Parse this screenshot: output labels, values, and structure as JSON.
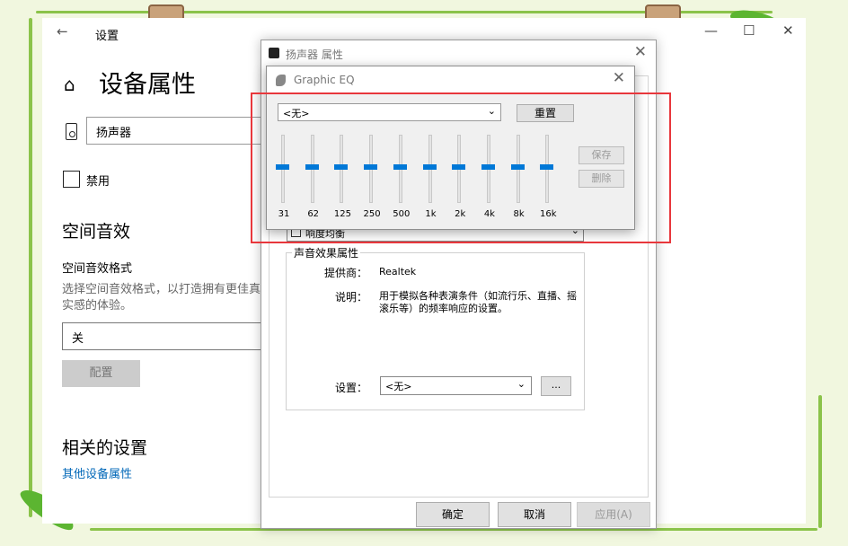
{
  "settings": {
    "title": "设置",
    "back_icon": "←",
    "controls": [
      "—",
      "☐",
      "✕"
    ],
    "home_icon": "⌂",
    "heading": "设备属性",
    "device_name": "扬声器",
    "disable_label": "禁用",
    "spatial_title": "空间音效",
    "spatial_format_label": "空间音效格式",
    "spatial_format_desc": "选择空间音效格式，以打造拥有更佳真实感的体验。",
    "spatial_format_value": "关",
    "config_button": "配置",
    "related_title": "相关的设置",
    "other_device_link": "其他设备属性"
  },
  "speaker_props": {
    "title": "扬声器 属性",
    "close": "✕",
    "preset_checkbox_text": "响度均衡",
    "group_label": "声音效果属性",
    "provider_label": "提供商：",
    "provider_value": "Realtek",
    "desc_label": "说明：",
    "desc_value": "用于模拟各种表演条件（如流行乐、直播、摇滚乐等）的频率响应的设置。",
    "setting_label": "设置：",
    "setting_value": "<无>",
    "more_button": "...",
    "ok_button": "确定",
    "cancel_button": "取消",
    "apply_button": "应用(A)"
  },
  "graphic_eq": {
    "title": "Graphic EQ",
    "close": "✕",
    "preset_value": "<无>",
    "reset_button": "重置",
    "save_button": "保存",
    "delete_button": "删除",
    "bands": [
      {
        "label": "31",
        "level": 0
      },
      {
        "label": "62",
        "level": 0
      },
      {
        "label": "125",
        "level": 0
      },
      {
        "label": "250",
        "level": 0
      },
      {
        "label": "500",
        "level": 0
      },
      {
        "label": "1k",
        "level": 0
      },
      {
        "label": "2k",
        "level": 0
      },
      {
        "label": "4k",
        "level": 0
      },
      {
        "label": "8k",
        "level": 0
      },
      {
        "label": "16k",
        "level": 0
      }
    ]
  },
  "colors": {
    "highlight": "#e8373c",
    "accent": "#0078d7",
    "link": "#0067b8",
    "frame_green": "#8bc34a"
  }
}
